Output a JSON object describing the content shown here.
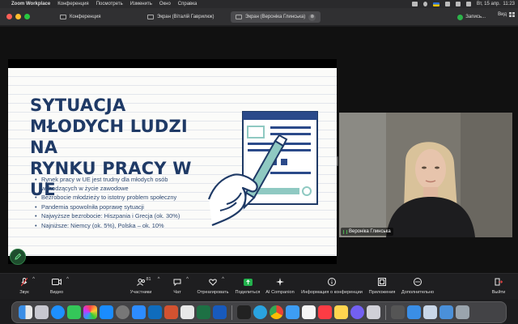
{
  "menubar": {
    "app": "Zoom Workplace",
    "items": [
      "Конференция",
      "Посмотреть",
      "Изменить",
      "Окно",
      "Справка"
    ],
    "datetime": "Вт, 15 апр.  11:23"
  },
  "titlebar": {
    "tabs": [
      {
        "label": "Конференция"
      },
      {
        "label": "Экран (Віталій Гаврилюк)"
      },
      {
        "label": "Экран (Вероніка Глинська)",
        "close": "⊗"
      }
    ],
    "record_label": "Запись...",
    "view_label": "Вид"
  },
  "slide": {
    "title_lines": [
      "SYTUACJA",
      "MŁODYCH LUDZI NA",
      "RYNKU PRACY W UE"
    ],
    "bullets": [
      "Rynek pracy w UE jest trudny dla młodych osób wchodzących w życie zawodowe",
      "Bezrobocie młodzieży to istotny problem społeczny",
      "Pandemia spowolniła poprawę sytuacji",
      "Najwyższe bezrobocie: Hiszpania i Grecja (ok. 30%)",
      "Najniższe: Niemcy (ok. 5%), Polska – ok. 10%"
    ],
    "colors": {
      "title": "#1f3a66",
      "accent": "#8fc9c2",
      "line": "#2b4a8a"
    }
  },
  "video": {
    "participant_name": "Вероніка Глинська"
  },
  "toolbar": {
    "items": [
      {
        "label": "Звук",
        "icon": "microphone-muted-icon"
      },
      {
        "label": "Видео",
        "icon": "camera-icon"
      },
      {
        "label": "Участники",
        "icon": "participants-icon",
        "count": "81"
      },
      {
        "label": "Чат",
        "icon": "chat-icon"
      },
      {
        "label": "Отреагировать",
        "icon": "react-icon"
      },
      {
        "label": "Поделиться",
        "icon": "share-icon"
      },
      {
        "label": "AI Companion",
        "icon": "ai-companion-icon"
      },
      {
        "label": "Информация о конференции",
        "icon": "info-icon"
      },
      {
        "label": "Приложения",
        "icon": "apps-icon"
      },
      {
        "label": "Дополнительно",
        "icon": "more-icon"
      },
      {
        "label": "Выйти",
        "icon": "leave-icon"
      }
    ]
  },
  "dock": {
    "apps": [
      "finder",
      "launchpad",
      "safari",
      "messages",
      "photos",
      "app-store",
      "system-settings",
      "zoom",
      "outlook",
      "powerpoint",
      "word-online",
      "excel",
      "word",
      "terminal",
      "telegram",
      "chrome",
      "mail",
      "calendar",
      "music",
      "notes",
      "viber",
      "preview",
      "activity",
      "finder-2",
      "photos-2",
      "downloads",
      "trash"
    ]
  }
}
